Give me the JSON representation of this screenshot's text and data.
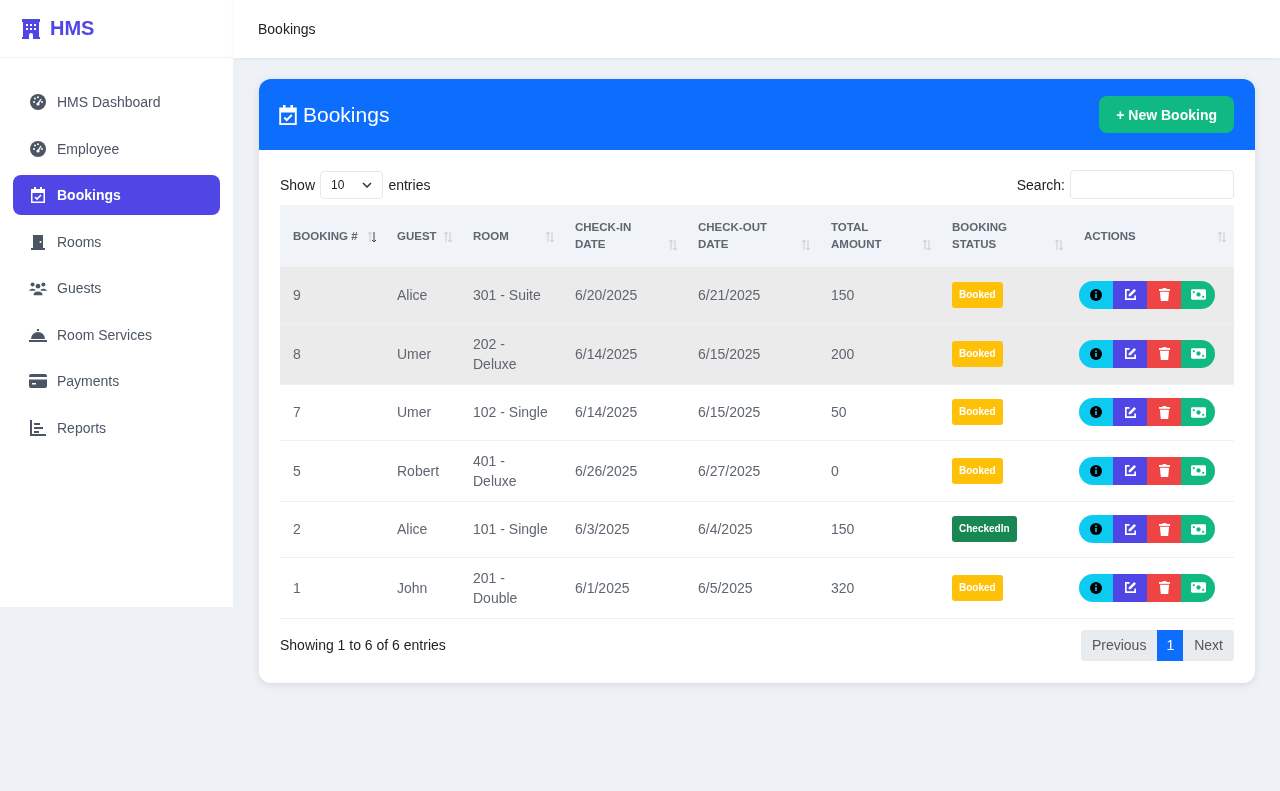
{
  "brand": {
    "name": "HMS"
  },
  "sidebar": {
    "items": [
      {
        "label": "HMS Dashboard",
        "selected": false
      },
      {
        "label": "Employee",
        "selected": false
      },
      {
        "label": "Bookings",
        "selected": true
      },
      {
        "label": "Rooms",
        "selected": false
      },
      {
        "label": "Guests",
        "selected": false
      },
      {
        "label": "Room Services",
        "selected": false
      },
      {
        "label": "Payments",
        "selected": false
      },
      {
        "label": "Reports",
        "selected": false
      }
    ]
  },
  "topbar": {
    "title": "Bookings"
  },
  "card": {
    "title": "Bookings",
    "new_button": "+ New Booking",
    "length": {
      "before": "Show",
      "value": "10",
      "after": "entries"
    },
    "search": {
      "label": "Search:"
    },
    "columns": [
      {
        "label": "BOOKING #",
        "sorted": true
      },
      {
        "label": "GUEST",
        "sorted": false
      },
      {
        "label": "ROOM",
        "sorted": false
      },
      {
        "label": "CHECK-IN DATE",
        "sorted": false
      },
      {
        "label": "CHECK-OUT DATE",
        "sorted": false
      },
      {
        "label": "TOTAL AMOUNT",
        "sorted": false
      },
      {
        "label": "BOOKING STATUS",
        "sorted": false
      },
      {
        "label": "ACTIONS",
        "sorted": false
      }
    ],
    "rows": [
      {
        "id": "9",
        "guest": "Alice",
        "room": "301 - Suite",
        "check_in": "6/20/2025",
        "check_out": "6/21/2025",
        "total": "150",
        "status": "Booked",
        "color": "#ffc107",
        "highlighted": true
      },
      {
        "id": "8",
        "guest": "Umer",
        "room": "202 - Deluxe",
        "check_in": "6/14/2025",
        "check_out": "6/15/2025",
        "total": "200",
        "status": "Booked",
        "color": "#ffc107",
        "highlighted": true
      },
      {
        "id": "7",
        "guest": "Umer",
        "room": "102 - Single",
        "check_in": "6/14/2025",
        "check_out": "6/15/2025",
        "total": "50",
        "status": "Booked",
        "color": "#ffc107",
        "highlighted": false
      },
      {
        "id": "5",
        "guest": "Robert",
        "room": "401 - Deluxe",
        "check_in": "6/26/2025",
        "check_out": "6/27/2025",
        "total": "0",
        "status": "Booked",
        "color": "#ffc107",
        "highlighted": false
      },
      {
        "id": "2",
        "guest": "Alice",
        "room": "101 - Single",
        "check_in": "6/3/2025",
        "check_out": "6/4/2025",
        "total": "150",
        "status": "CheckedIn",
        "color": "#198754",
        "highlighted": false
      },
      {
        "id": "1",
        "guest": "John",
        "room": "201 - Double",
        "check_in": "6/1/2025",
        "check_out": "6/5/2025",
        "total": "320",
        "status": "Booked",
        "color": "#ffc107",
        "highlighted": false
      }
    ],
    "info": "Showing 1 to 6 of 6 entries",
    "pagination": [
      {
        "label": "Previous",
        "selected": false
      },
      {
        "label": "1",
        "selected": true
      },
      {
        "label": "Next",
        "selected": false
      }
    ]
  }
}
